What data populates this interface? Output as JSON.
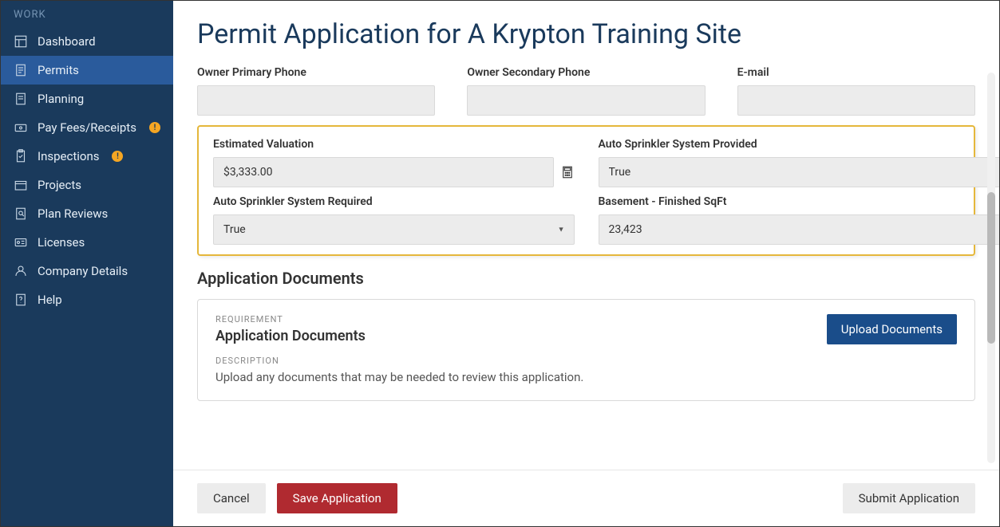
{
  "sidebar": {
    "header": "WORK",
    "items": [
      {
        "label": "Dashboard",
        "icon": "dashboard",
        "active": false,
        "alert": false
      },
      {
        "label": "Permits",
        "icon": "permits",
        "active": true,
        "alert": false
      },
      {
        "label": "Planning",
        "icon": "planning",
        "active": false,
        "alert": false
      },
      {
        "label": "Pay Fees/Receipts",
        "icon": "fees",
        "active": false,
        "alert": true
      },
      {
        "label": "Inspections",
        "icon": "inspections",
        "active": false,
        "alert": true
      },
      {
        "label": "Projects",
        "icon": "projects",
        "active": false,
        "alert": false
      },
      {
        "label": "Plan Reviews",
        "icon": "planreviews",
        "active": false,
        "alert": false
      },
      {
        "label": "Licenses",
        "icon": "licenses",
        "active": false,
        "alert": false
      },
      {
        "label": "Company Details",
        "icon": "company",
        "active": false,
        "alert": false
      },
      {
        "label": "Help",
        "icon": "help",
        "active": false,
        "alert": false
      }
    ]
  },
  "page": {
    "title": "Permit Application for A Krypton Training Site"
  },
  "fields": {
    "owner_primary_phone": {
      "label": "Owner Primary Phone",
      "value": ""
    },
    "owner_secondary_phone": {
      "label": "Owner Secondary Phone",
      "value": ""
    },
    "email": {
      "label": "E-mail",
      "value": ""
    },
    "estimated_valuation": {
      "label": "Estimated Valuation",
      "value": "$3,333.00"
    },
    "auto_sprinkler_provided": {
      "label": "Auto Sprinkler System Provided",
      "value": "True"
    },
    "auto_sprinkler_required": {
      "label": "Auto Sprinkler System Required",
      "value": "True"
    },
    "basement_finished_sqft": {
      "label": "Basement - Finished SqFt",
      "value": "23,423"
    }
  },
  "documents": {
    "section_title": "Application Documents",
    "requirement_label": "REQUIREMENT",
    "requirement_value": "Application Documents",
    "description_label": "DESCRIPTION",
    "description_value": "Upload any documents that may be needed to review this application.",
    "upload_button": "Upload Documents"
  },
  "footer": {
    "cancel": "Cancel",
    "save": "Save Application",
    "submit": "Submit Application"
  },
  "alert_glyph": "!"
}
